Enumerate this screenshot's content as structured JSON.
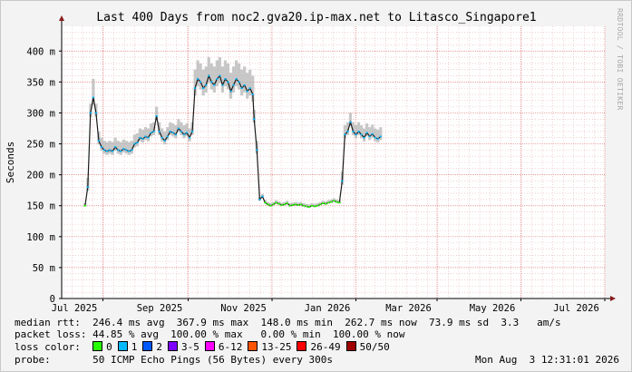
{
  "chart_data": {
    "type": "area",
    "title": "Last 400 Days from noc2.gva20.ip-max.net to Litasco_Singapore1",
    "ylabel": "Seconds",
    "xlabel": "",
    "ylim": [
      0,
      0.44
    ],
    "y_ticks": [
      {
        "v": 0,
        "label": "0"
      },
      {
        "v": 0.05,
        "label": "50 m"
      },
      {
        "v": 0.1,
        "label": "100 m"
      },
      {
        "v": 0.15,
        "label": "150 m"
      },
      {
        "v": 0.2,
        "label": "200 m"
      },
      {
        "v": 0.25,
        "label": "250 m"
      },
      {
        "v": 0.3,
        "label": "300 m"
      },
      {
        "v": 0.35,
        "label": "350 m"
      },
      {
        "v": 0.4,
        "label": "400 m"
      }
    ],
    "x_ticks": [
      "Jul 2025",
      "Sep 2025",
      "Nov 2025",
      "Jan 2026",
      "Mar 2026",
      "May 2026",
      "Jul 2026"
    ],
    "x_unit": "days from 2025-07-01",
    "grid": true,
    "series": [
      {
        "name": "median rtt",
        "points": [
          [
            17,
            0.15
          ],
          [
            19,
            0.18
          ],
          [
            21,
            0.3
          ],
          [
            23,
            0.325
          ],
          [
            25,
            0.3
          ],
          [
            27,
            0.255
          ],
          [
            29,
            0.245
          ],
          [
            31,
            0.24
          ],
          [
            33,
            0.238
          ],
          [
            35,
            0.24
          ],
          [
            37,
            0.238
          ],
          [
            39,
            0.245
          ],
          [
            41,
            0.24
          ],
          [
            43,
            0.238
          ],
          [
            45,
            0.242
          ],
          [
            47,
            0.24
          ],
          [
            49,
            0.238
          ],
          [
            51,
            0.24
          ],
          [
            53,
            0.25
          ],
          [
            55,
            0.252
          ],
          [
            57,
            0.26
          ],
          [
            59,
            0.258
          ],
          [
            61,
            0.262
          ],
          [
            63,
            0.26
          ],
          [
            65,
            0.268
          ],
          [
            67,
            0.27
          ],
          [
            69,
            0.295
          ],
          [
            71,
            0.27
          ],
          [
            73,
            0.26
          ],
          [
            75,
            0.255
          ],
          [
            77,
            0.262
          ],
          [
            79,
            0.27
          ],
          [
            81,
            0.268
          ],
          [
            83,
            0.265
          ],
          [
            85,
            0.275
          ],
          [
            87,
            0.27
          ],
          [
            89,
            0.265
          ],
          [
            91,
            0.268
          ],
          [
            93,
            0.26
          ],
          [
            95,
            0.27
          ],
          [
            97,
            0.34
          ],
          [
            99,
            0.355
          ],
          [
            101,
            0.35
          ],
          [
            103,
            0.34
          ],
          [
            105,
            0.345
          ],
          [
            107,
            0.36
          ],
          [
            109,
            0.35
          ],
          [
            111,
            0.345
          ],
          [
            113,
            0.355
          ],
          [
            115,
            0.36
          ],
          [
            117,
            0.345
          ],
          [
            119,
            0.355
          ],
          [
            121,
            0.35
          ],
          [
            123,
            0.335
          ],
          [
            125,
            0.345
          ],
          [
            127,
            0.355
          ],
          [
            129,
            0.35
          ],
          [
            131,
            0.34
          ],
          [
            133,
            0.345
          ],
          [
            135,
            0.335
          ],
          [
            137,
            0.34
          ],
          [
            139,
            0.33
          ],
          [
            140,
            0.29
          ],
          [
            142,
            0.24
          ],
          [
            144,
            0.16
          ],
          [
            146,
            0.165
          ],
          [
            148,
            0.155
          ],
          [
            150,
            0.152
          ],
          [
            152,
            0.15
          ],
          [
            154,
            0.152
          ],
          [
            156,
            0.155
          ],
          [
            158,
            0.153
          ],
          [
            160,
            0.151
          ],
          [
            162,
            0.152
          ],
          [
            164,
            0.154
          ],
          [
            166,
            0.15
          ],
          [
            168,
            0.151
          ],
          [
            170,
            0.152
          ],
          [
            172,
            0.151
          ],
          [
            174,
            0.152
          ],
          [
            176,
            0.15
          ],
          [
            178,
            0.149
          ],
          [
            180,
            0.148
          ],
          [
            182,
            0.15
          ],
          [
            184,
            0.149
          ],
          [
            186,
            0.15
          ],
          [
            188,
            0.152
          ],
          [
            190,
            0.154
          ],
          [
            192,
            0.153
          ],
          [
            194,
            0.155
          ],
          [
            196,
            0.156
          ],
          [
            198,
            0.158
          ],
          [
            200,
            0.156
          ],
          [
            202,
            0.155
          ],
          [
            204,
            0.19
          ],
          [
            206,
            0.265
          ],
          [
            208,
            0.27
          ],
          [
            210,
            0.285
          ],
          [
            212,
            0.27
          ],
          [
            214,
            0.265
          ],
          [
            216,
            0.27
          ],
          [
            218,
            0.265
          ],
          [
            220,
            0.26
          ],
          [
            222,
            0.268
          ],
          [
            224,
            0.262
          ],
          [
            226,
            0.266
          ],
          [
            228,
            0.26
          ],
          [
            230,
            0.258
          ],
          [
            232,
            0.262
          ]
        ]
      }
    ]
  },
  "stats": {
    "line1": "median rtt:  246.4 ms avg  367.9 ms max  148.0 ms min  262.7 ms now  73.9 ms sd  3.3   am/s",
    "line2": "packet loss: 44.85 % avg  100.00 % max   0.00 % min  100.00 % now"
  },
  "loss_color": {
    "label": "loss color:",
    "items": [
      {
        "label": "0",
        "color": "#26ff00"
      },
      {
        "label": "1",
        "color": "#00b8ff"
      },
      {
        "label": "2",
        "color": "#0059ff"
      },
      {
        "label": "3-5",
        "color": "#7e00ff"
      },
      {
        "label": "6-12",
        "color": "#ff00ff"
      },
      {
        "label": "13-25",
        "color": "#ff5500"
      },
      {
        "label": "26-49",
        "color": "#ff0000"
      },
      {
        "label": "50/50",
        "color": "#a10000"
      }
    ]
  },
  "probe": {
    "label": "probe:",
    "text": "50 ICMP Echo Pings (56 Bytes) every 300s",
    "date": "Mon Aug  3 12:31:01 2026"
  },
  "credit": "RRDTOOL / TOBI OETIKER"
}
